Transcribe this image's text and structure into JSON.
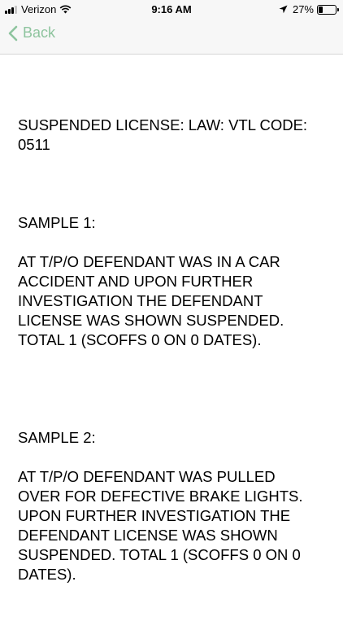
{
  "status_bar": {
    "carrier": "Verizon",
    "time": "9:16 AM",
    "battery": "27%",
    "battery_level": 0.27,
    "icons": [
      "signal-bars-icon",
      "wifi-icon",
      "location-arrow-icon",
      "battery-icon"
    ]
  },
  "nav": {
    "back_label": "Back",
    "accent_color": "#8ec49e"
  },
  "content": {
    "heading": "SUSPENDED LICENSE: LAW: VTL CODE:\n0511",
    "sample1_title": "SAMPLE 1:",
    "sample1_text": "AT T/P/O DEFENDANT WAS IN A CAR\nACCIDENT AND UPON FURTHER\nINVESTIGATION THE DEFENDANT\nLICENSE WAS SHOWN SUSPENDED.\nTOTAL 1 (SCOFFS 0 ON 0 DATES).",
    "sample2_title": "SAMPLE 2:",
    "sample2_text": "AT T/P/O DEFENDANT WAS PULLED\nOVER FOR DEFECTIVE BRAKE LIGHTS.\nUPON FURTHER INVESTIGATION THE\nDEFENDANT LICENSE WAS SHOWN\nSUSPENDED. TOTAL 1 (SCOFFS 0 ON 0\nDATES)."
  }
}
